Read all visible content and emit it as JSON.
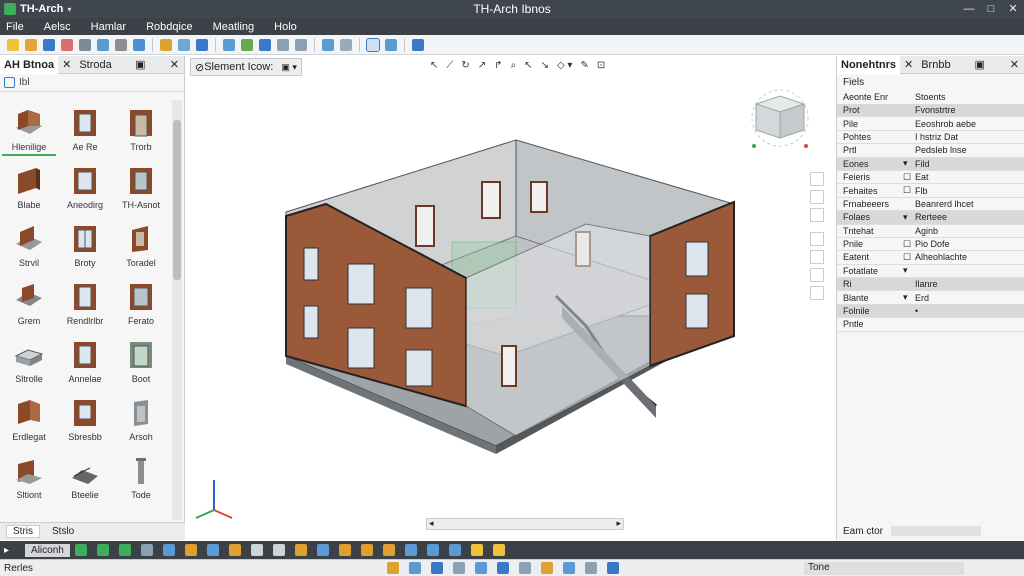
{
  "window": {
    "app_title": "TH-Arch",
    "doc_title": "TH-Arch Ibnos",
    "minimize": "—",
    "maximize": "□",
    "close": "✕"
  },
  "menu": [
    "File",
    "Aelsc",
    "Hamlar",
    "Robdqice",
    "Meatling",
    "Holo"
  ],
  "library_panel": {
    "tab_active": "AH Btnoa",
    "tab_other": "Stroda",
    "close": "✕",
    "filter_label": "Ibl",
    "items": [
      "Hlenilige",
      "Ae Re",
      "Trorb",
      "Blabe",
      "Aneodirg",
      "TH-Asnot",
      "Strvil",
      "Broty",
      "Toradel",
      "Grem",
      "Rendlrlbr",
      "Ferato",
      "Sltrolle",
      "Annelae",
      "Boot",
      "Erdlegat",
      "Sbresbb",
      "Arsoh",
      "Sltiont",
      "Bteelie",
      "Tode"
    ],
    "bottom_tabs": [
      "Stris",
      "Stslo"
    ]
  },
  "viewport": {
    "tab_label": "Slement Icow:",
    "scroll_mid": "·"
  },
  "properties": {
    "tab_active": "Nonehtnrs",
    "tab_other": "Brnbb",
    "header": "Fiels",
    "col1": "Aeonte Enr",
    "col2": "Stoents",
    "rows": [
      {
        "k": "Prot",
        "c": "",
        "v": "Fvonstrtre"
      },
      {
        "k": "Pile",
        "c": "",
        "v": "Eeoshrob aebe"
      },
      {
        "k": "Pohtes",
        "c": "",
        "v": "I hstriz Dat"
      },
      {
        "k": "Prtl",
        "c": "",
        "v": "Pedsleb lnse"
      },
      {
        "k": "Eones",
        "c": "▾",
        "v": "Fild"
      },
      {
        "k": "Feieris",
        "c": "☐",
        "v": "Eat"
      },
      {
        "k": "Fehaites",
        "c": "☐",
        "v": "Flb"
      },
      {
        "k": "Frnabeeers",
        "c": "",
        "v": "Beanrerd lhcet"
      },
      {
        "k": "Folaes",
        "c": "▾",
        "v": "Rerteee"
      },
      {
        "k": "Tntehat",
        "c": "",
        "v": "Aginb"
      },
      {
        "k": "Pnile",
        "c": "☐",
        "v": "Pio   Dofe"
      },
      {
        "k": "Eatent",
        "c": "☐",
        "v": "Alheohlachte"
      },
      {
        "k": "Fotatlate",
        "c": "▾",
        "v": ""
      },
      {
        "k": "Ri",
        "c": "",
        "v": "Ilanre"
      },
      {
        "k": "Blante",
        "c": "▾",
        "v": "Erd"
      },
      {
        "k": "Folnile",
        "c": "",
        "v": "•"
      },
      {
        "k": "Pntle",
        "c": "",
        "v": ""
      }
    ],
    "bottom_label": "Eam ctor"
  },
  "bottom_toolbar": {
    "label": "Aliconh"
  },
  "status": {
    "left": "Rerles",
    "right": "Tone"
  },
  "colors": {
    "accent": "#3a78c8",
    "dark_bar": "#3b4147",
    "wall": "#9a5a3a"
  }
}
